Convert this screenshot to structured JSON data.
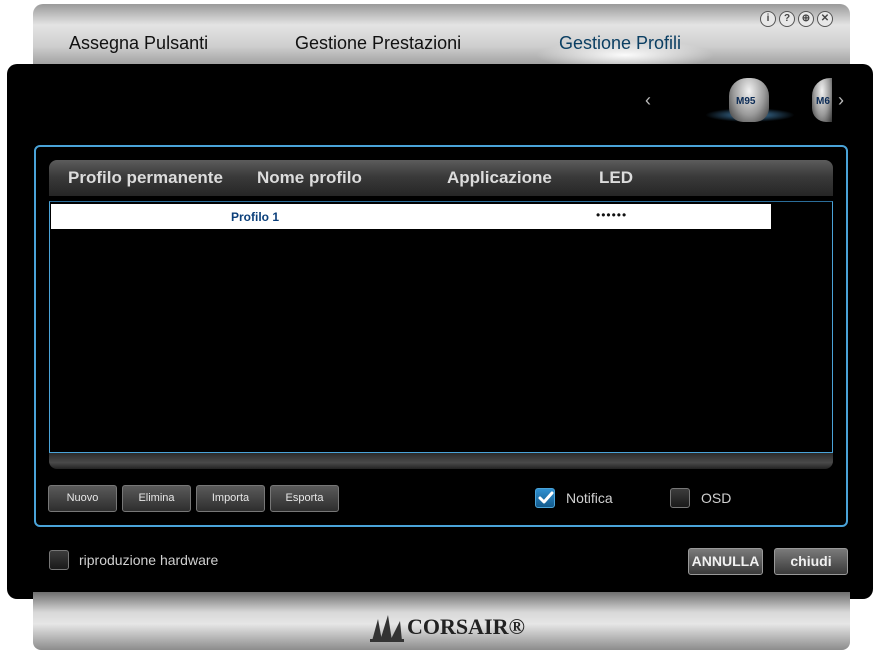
{
  "tabs": [
    {
      "label": "Assegna Pulsanti",
      "active": false
    },
    {
      "label": "Gestione Prestazioni",
      "active": false
    },
    {
      "label": "Gestione Profili",
      "active": true
    }
  ],
  "window_icons": [
    {
      "icon": "info-icon",
      "glyph": "i"
    },
    {
      "icon": "help-icon",
      "glyph": "?"
    },
    {
      "icon": "globe-icon",
      "glyph": "⊕"
    },
    {
      "icon": "close-icon",
      "glyph": "✕"
    }
  ],
  "devices": [
    {
      "label": "M95",
      "selected": true
    },
    {
      "label": "M6",
      "selected": false
    }
  ],
  "table": {
    "columns": [
      "Profilo permanente",
      "Nome profilo",
      "Applicazione",
      "LED"
    ],
    "rows": [
      {
        "permanent": "",
        "name": "Profilo 1",
        "application": "",
        "led": "••••••",
        "selected": true
      }
    ]
  },
  "actions": {
    "new": "Nuovo",
    "delete": "Elimina",
    "import": "Importa",
    "export": "Esporta"
  },
  "options": {
    "notifica": {
      "label": "Notifica",
      "checked": true
    },
    "osd": {
      "label": "OSD",
      "checked": false
    },
    "hardware_playback": {
      "label": "riproduzione hardware",
      "checked": false
    }
  },
  "footer_buttons": {
    "cancel": "ANNULLA",
    "close": "chiudi"
  },
  "brand": {
    "name": "CORSAIR®"
  },
  "colors": {
    "accent": "#4aa3d8",
    "active_tab": "#0b3f63"
  }
}
